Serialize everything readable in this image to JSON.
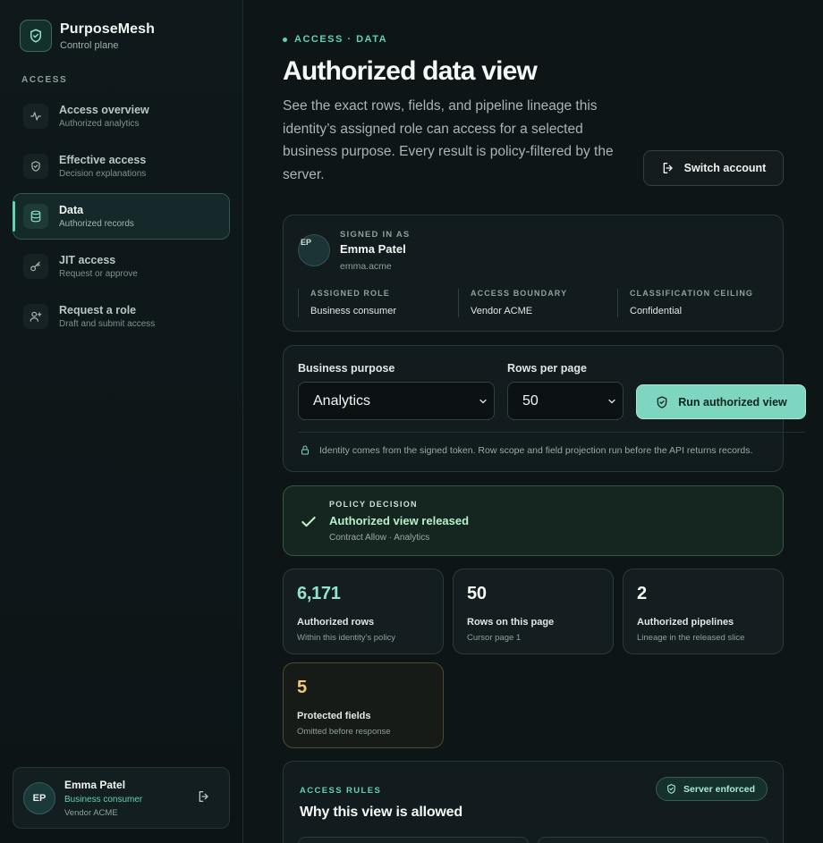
{
  "brand": {
    "name": "PurposeMesh",
    "subtitle": "Control plane",
    "logo_icon": "shield-check-icon"
  },
  "nav": {
    "section_label": "ACCESS",
    "items": [
      {
        "label": "Access overview",
        "sub": "Authorized analytics",
        "icon": "activity-icon",
        "active": false
      },
      {
        "label": "Effective access",
        "sub": "Decision explanations",
        "icon": "shield-check-icon",
        "active": false
      },
      {
        "label": "Data",
        "sub": "Authorized records",
        "icon": "database-icon",
        "active": true
      },
      {
        "label": "JIT access",
        "sub": "Request or approve",
        "icon": "key-icon",
        "active": false
      },
      {
        "label": "Request a role",
        "sub": "Draft and submit access",
        "icon": "user-plus-icon",
        "active": false
      }
    ]
  },
  "user_card": {
    "initials": "EP",
    "name": "Emma Patel",
    "role": "Business consumer",
    "org": "Vendor ACME",
    "logout_icon": "logout-icon"
  },
  "header": {
    "eyebrow": "ACCESS · DATA",
    "title": "Authorized data view",
    "description": "See the exact rows, fields, and pipeline lineage this identity’s assigned role can access for a selected business purpose. Every result is policy-filtered by the server.",
    "switch_account_label": "Switch account"
  },
  "identity": {
    "avatar_initials": "EP",
    "signed_in_label": "SIGNED IN AS",
    "name": "Emma Patel",
    "email": "emma.acme",
    "attributes": [
      {
        "key": "ASSIGNED ROLE",
        "value": "Business consumer"
      },
      {
        "key": "ACCESS BOUNDARY",
        "value": "Vendor ACME"
      },
      {
        "key": "CLASSIFICATION CEILING",
        "value": "Confidential"
      }
    ]
  },
  "query": {
    "purpose_label": "Business purpose",
    "purpose_value": "Analytics",
    "rows_label": "Rows per page",
    "rows_value": "50",
    "run_label": "Run authorized view",
    "note": "Identity comes from the signed token. Row scope and field projection run before the API returns records."
  },
  "policy": {
    "label": "POLICY DECISION",
    "title": "Authorized view released",
    "sub": "Contract Allow · Analytics"
  },
  "stats": [
    {
      "value": "6,171",
      "label": "Authorized rows",
      "sub": "Within this identity's policy"
    },
    {
      "value": "50",
      "label": "Rows on this page",
      "sub": "Cursor page 1"
    },
    {
      "value": "2",
      "label": "Authorized pipelines",
      "sub": "Lineage in the released slice"
    },
    {
      "value": "5",
      "label": "Protected fields",
      "sub": "Omitted before response"
    }
  ],
  "rules": {
    "eyebrow": "ACCESS RULES",
    "title": "Why this view is allowed",
    "badge": "Server enforced"
  },
  "colors": {
    "accent": "#5fd3b4",
    "run_button": "#7fd6c0",
    "success": "#b9f0c8",
    "warning": "#f2c978",
    "background": "#0d1516"
  }
}
